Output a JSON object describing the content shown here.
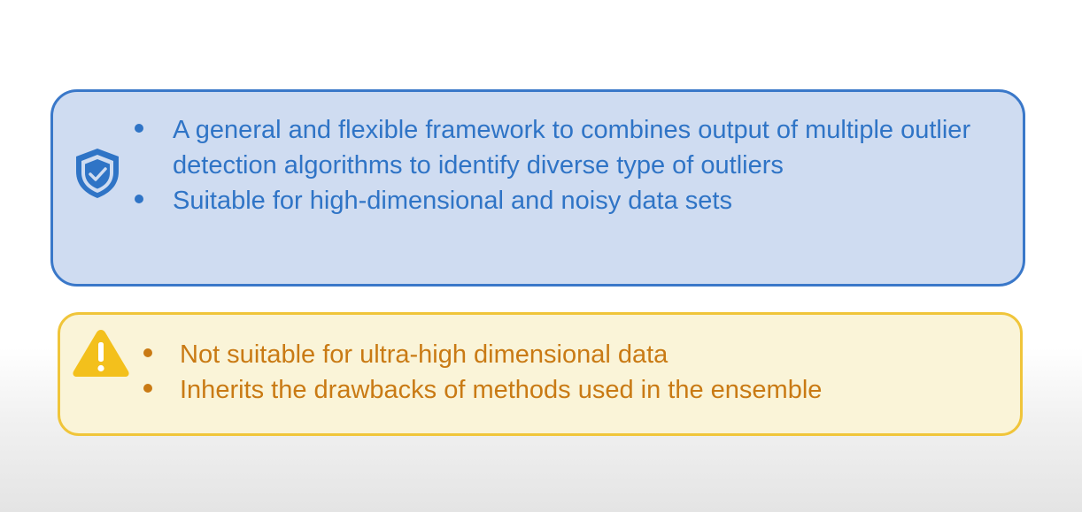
{
  "pros": {
    "icon": "shield-check-icon",
    "color": "#2f74c6",
    "border_color": "#3a78c9",
    "background": "#cfdcf1",
    "items": [
      "A general and flexible framework to combines output of multiple outlier detection algorithms to identify diverse type of outliers",
      "Suitable for high-dimensional and noisy data sets"
    ]
  },
  "cons": {
    "icon": "warning-icon",
    "color": "#c97a14",
    "border_color": "#f0c53a",
    "background": "#faf4d8",
    "items": [
      "Not suitable for ultra-high dimensional data",
      "Inherits the drawbacks of methods used in the ensemble"
    ]
  }
}
